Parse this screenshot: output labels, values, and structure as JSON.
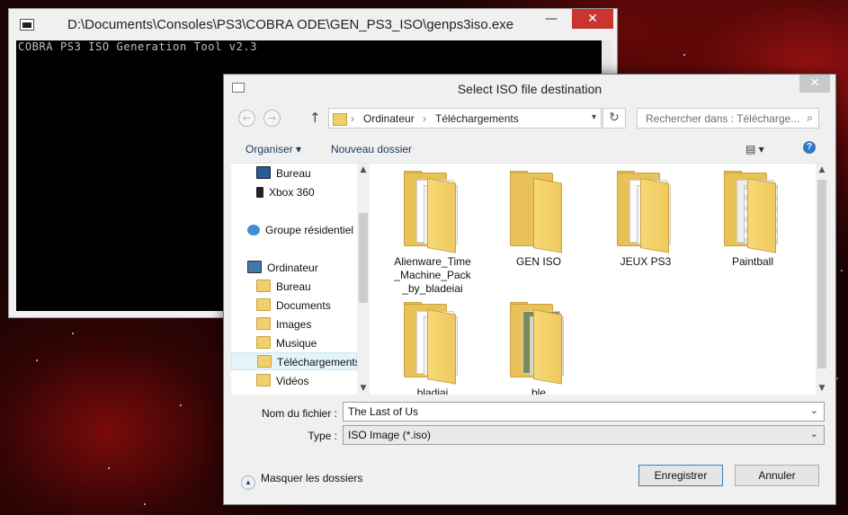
{
  "console": {
    "title": "D:\\Documents\\Consoles\\PS3\\COBRA ODE\\GEN_PS3_ISO\\genps3iso.exe",
    "output": "COBRA PS3 ISO Generation Tool v2.3",
    "minimize": "—",
    "close": "✕"
  },
  "dialog": {
    "title": "Select ISO file destination",
    "close": "✕",
    "nav": {
      "back": "←",
      "forward": "→",
      "up": "↑",
      "path": [
        "Ordinateur",
        "Téléchargements"
      ],
      "separator": "›",
      "refresh": "↻",
      "search_placeholder": "Rechercher dans : Télécharge...",
      "search_icon": "⌕"
    },
    "toolbar": {
      "organize": "Organiser ▾",
      "new_folder": "Nouveau dossier",
      "view": "▤ ▾",
      "help": "?"
    },
    "tree": [
      {
        "label": "Bureau",
        "icon": "monitor-icon"
      },
      {
        "label": "Xbox 360",
        "icon": "xbox-icon"
      },
      {
        "label": "Groupe résidentiel",
        "icon": "homegroup-icon"
      },
      {
        "label": "Ordinateur",
        "icon": "computer-icon"
      },
      {
        "label": "Bureau",
        "icon": "folder-icon"
      },
      {
        "label": "Documents",
        "icon": "folder-icon"
      },
      {
        "label": "Images",
        "icon": "folder-icon"
      },
      {
        "label": "Musique",
        "icon": "folder-icon"
      },
      {
        "label": "Téléchargements",
        "icon": "download-folder-icon"
      },
      {
        "label": "Vidéos",
        "icon": "folder-icon"
      }
    ],
    "files": [
      {
        "name": "Alienware_Time_Machine_Pack_by_bladeiai"
      },
      {
        "name": "GEN ISO"
      },
      {
        "name": "JEUX PS3"
      },
      {
        "name": "Paintball"
      },
      {
        "name": "...bladiai..."
      },
      {
        "name": "...ble..."
      }
    ],
    "filename_label": "Nom du fichier :",
    "filename_value": "The Last of Us",
    "type_label": "Type :",
    "type_value": "ISO Image (*.iso)",
    "hide_folders": "Masquer les dossiers",
    "save": "Enregistrer",
    "cancel": "Annuler"
  }
}
